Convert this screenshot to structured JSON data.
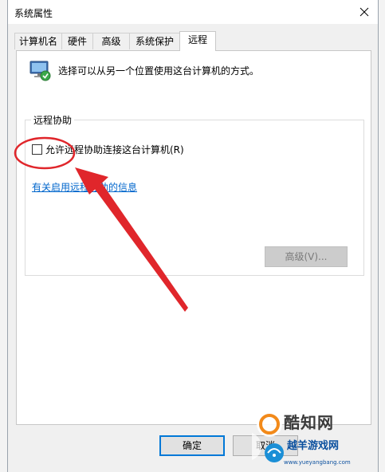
{
  "window": {
    "title": "系统属性"
  },
  "tabs": [
    {
      "label": "计算机名",
      "active": false
    },
    {
      "label": "硬件",
      "active": false
    },
    {
      "label": "高级",
      "active": false
    },
    {
      "label": "系统保护",
      "active": false
    },
    {
      "label": "远程",
      "active": true
    }
  ],
  "remote_panel": {
    "intro_text": "选择可以从另一个位置使用这台计算机的方式。",
    "remote_assistance": {
      "group_title": "远程协助",
      "checkbox_label": "允许远程协助连接这台计算机(R)",
      "checkbox_checked": false,
      "help_link": "有关启用远程协助的信息",
      "advanced_button": "高级(V)..."
    }
  },
  "footer": {
    "ok_label": "确定",
    "cancel_label": "取消"
  },
  "watermark": {
    "name": "酷知网",
    "subtitle": "越羊游戏网",
    "url": "www.yueyangbang.com"
  },
  "colors": {
    "accent": "#0078d7",
    "link": "#0066cc",
    "annotation": "#e0262b"
  }
}
